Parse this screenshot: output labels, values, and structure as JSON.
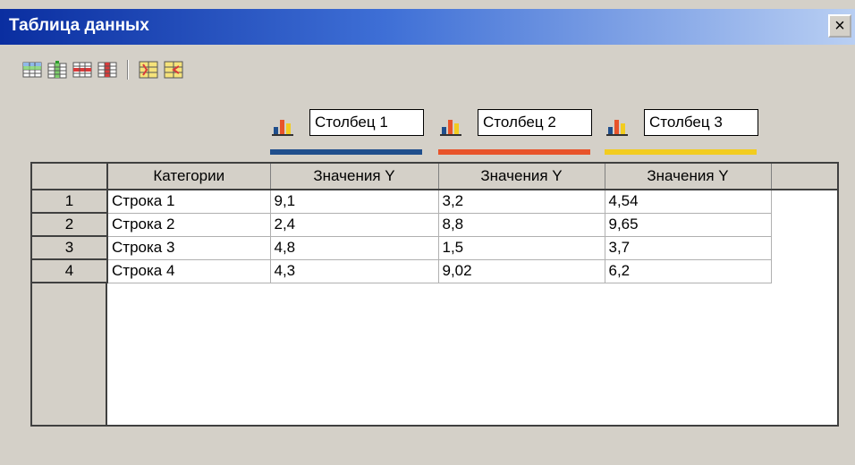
{
  "window": {
    "title": "Таблица данных",
    "close_glyph": "×"
  },
  "toolbar": {
    "icons": [
      "insert-row-icon",
      "insert-column-icon",
      "delete-row-icon",
      "delete-column-icon",
      "swap-rows-icon",
      "swap-columns-icon"
    ]
  },
  "series": [
    {
      "name": "Столбец 1",
      "color": "#1f4e8c"
    },
    {
      "name": "Столбец 2",
      "color": "#e8532a"
    },
    {
      "name": "Столбец 3",
      "color": "#f2cc1f"
    }
  ],
  "table": {
    "headers": [
      "Категории",
      "Значения Y",
      "Значения Y",
      "Значения Y"
    ],
    "rows": [
      {
        "num": "1",
        "category": "Строка 1",
        "values": [
          "9,1",
          "3,2",
          "4,54"
        ]
      },
      {
        "num": "2",
        "category": "Строка 2",
        "values": [
          "2,4",
          "8,8",
          "9,65"
        ]
      },
      {
        "num": "3",
        "category": "Строка 3",
        "values": [
          "4,8",
          "1,5",
          "3,7"
        ]
      },
      {
        "num": "4",
        "category": "Строка 4",
        "values": [
          "4,3",
          "9,02",
          "6,2"
        ]
      }
    ]
  }
}
